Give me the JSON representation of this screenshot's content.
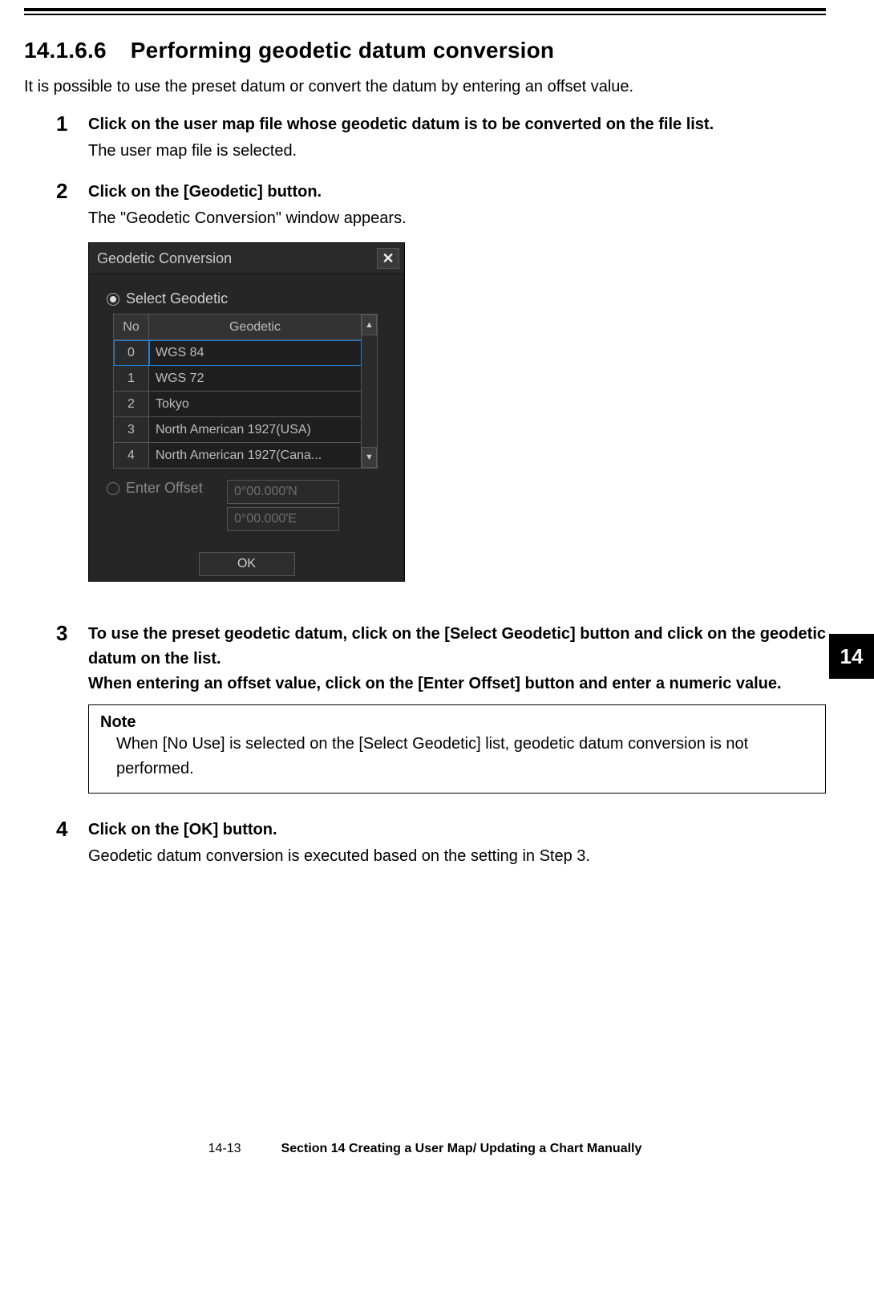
{
  "heading": {
    "number": "14.1.6.6",
    "title": "Performing geodetic datum conversion"
  },
  "intro": "It is possible to use the preset datum or convert the datum by entering an offset value.",
  "steps": {
    "s1": {
      "num": "1",
      "title": "Click on the user map file whose geodetic datum is to be converted on the file list.",
      "desc": "The user map file is selected."
    },
    "s2": {
      "num": "2",
      "title": "Click on the [Geodetic] button.",
      "desc": "The \"Geodetic Conversion\" window appears."
    },
    "s3": {
      "num": "3",
      "title_a": "To use the preset geodetic datum, click on the [Select Geodetic] button and click on the geodetic datum on the list.",
      "title_b": "When entering an offset value, click on the [Enter Offset] button and enter a numeric value.",
      "note_label": "Note",
      "note_text": "When [No Use] is selected on the [Select Geodetic] list, geodetic datum conversion is not performed."
    },
    "s4": {
      "num": "4",
      "title": "Click on the [OK] button.",
      "desc": "Geodetic datum conversion is executed based on the setting in Step 3."
    }
  },
  "dialog": {
    "title": "Geodetic Conversion",
    "close": "✕",
    "select_label": "Select Geodetic",
    "cols": {
      "no": "No",
      "geo": "Geodetic"
    },
    "rows": [
      {
        "no": "0",
        "name": "WGS 84"
      },
      {
        "no": "1",
        "name": "WGS 72"
      },
      {
        "no": "2",
        "name": "Tokyo"
      },
      {
        "no": "3",
        "name": "North American 1927(USA)"
      },
      {
        "no": "4",
        "name": "North American 1927(Cana..."
      }
    ],
    "scroll_up": "▲",
    "scroll_down": "▼",
    "enter_offset_label": "Enter Offset",
    "offset_n": "0°00.000'N",
    "offset_e": "0°00.000'E",
    "ok": "OK"
  },
  "side_tab": "14",
  "footer": {
    "page": "14-13",
    "section": "Section 14    Creating a User Map/ Updating a Chart Manually"
  }
}
